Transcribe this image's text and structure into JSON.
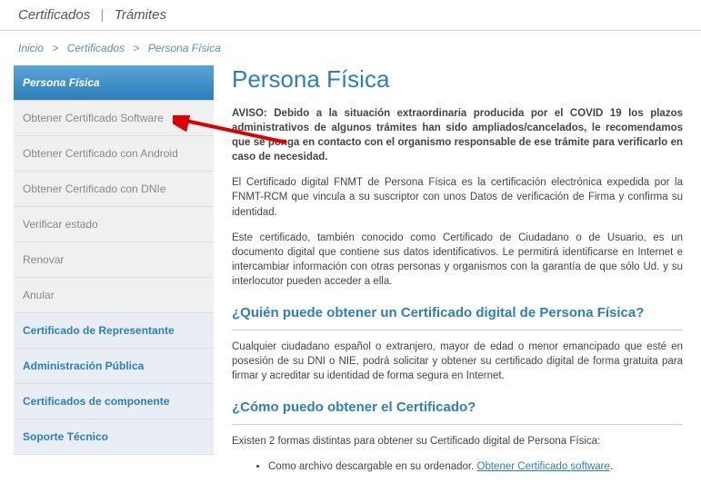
{
  "topnav": {
    "item1": "Certificados",
    "item2": "Trámites",
    "sep": "|"
  },
  "breadcrumb": {
    "item1": "Inicio",
    "item2": "Certificados",
    "item3": "Persona Física",
    "sep": ">"
  },
  "sidebar": {
    "active": "Persona Física",
    "subs": [
      "Obtener Certificado Software",
      "Obtener Certificado con Android",
      "Obtener Certificado con DNIe",
      "Verificar estado",
      "Renovar",
      "Anular"
    ],
    "sections": [
      "Certificado de Representante",
      "Administración Pública",
      "Certificados de componente",
      "Soporte Técnico"
    ]
  },
  "content": {
    "title": "Persona Física",
    "aviso": "AVISO: Debido a la situación extraordinaria producida por el COVID 19 los plazos administrativos de algunos trámites han sido ampliados/cancelados, le recomendamos que se ponga en contacto con el organismo responsable de ese trámite para verificarlo en caso de necesidad.",
    "p1": "El Certificado digital FNMT de Persona Física es la certificación electrónica expedida por la FNMT-RCM que vincula a su suscriptor con unos Datos de verificación de Firma y confirma su identidad.",
    "p2": "Este certificado, también conocido como Certificado de Ciudadano o de Usuario, es un documento digital que contiene sus datos identificativos. Le permitirá identificarse en Internet e intercambiar información con otras personas y organismos con la garantía de que sólo Ud. y su interlocutor pueden acceder a ella.",
    "h2a": "¿Quién puede obtener un Certificado digital de Persona Física?",
    "p3": "Cualquier ciudadano español o extranjero, mayor de edad o menor emancipado que esté en posesión de su DNI o NIE, podrá solicitar y obtener su certificado digital de forma gratuita para firmar y acreditar su identidad de forma segura en Internet.",
    "h2b": "¿Cómo puedo obtener el Certificado?",
    "p4": "Existen 2 formas distintas para obtener su Certificado digital de Persona Física:",
    "li1_pre": "Como archivo descargable en su ordenador. ",
    "li1_link": "Obtener Certificado software",
    "li1_post": "."
  }
}
